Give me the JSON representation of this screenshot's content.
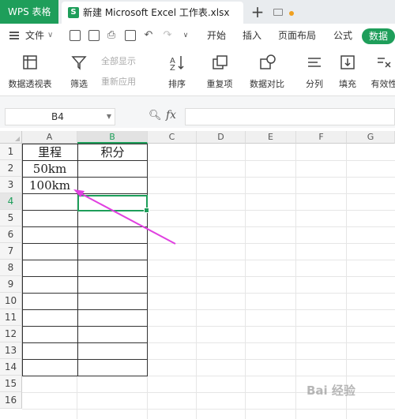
{
  "titlebar": {
    "app_tab": "WPS 表格",
    "file_tab_icon": "S",
    "file_tab_name": "新建 Microsoft Excel 工作表.xlsx",
    "new_tab": "+"
  },
  "menu": {
    "file_label": "文件",
    "tabs": [
      "开始",
      "插入",
      "页面布局",
      "公式"
    ],
    "active_tab": "数据"
  },
  "ribbon": {
    "pivot": "数据透视表",
    "filter": "筛选",
    "show_all": "全部显示",
    "reapply": "重新应用",
    "sort": "排序",
    "duplicates": "重复项",
    "compare": "数据对比",
    "split": "分列",
    "fill": "填充",
    "validity": "有效性"
  },
  "formula_bar": {
    "name_box": "B4",
    "fx": "fx",
    "value": ""
  },
  "sheet": {
    "columns": [
      "A",
      "B",
      "C",
      "D",
      "E",
      "F",
      "G"
    ],
    "selected_column": "B",
    "rows": [
      "1",
      "2",
      "3",
      "4",
      "5",
      "6",
      "7",
      "8",
      "9",
      "10",
      "11",
      "12",
      "13",
      "14",
      "15",
      "16"
    ],
    "selected_row": "4",
    "cells": {
      "A1": "里程",
      "B1": "积分",
      "A2": "50km",
      "A3": "100km"
    },
    "active_cell": "B4",
    "annotation_arrow_color": "#e040e0"
  },
  "watermark": "Bai 经验"
}
